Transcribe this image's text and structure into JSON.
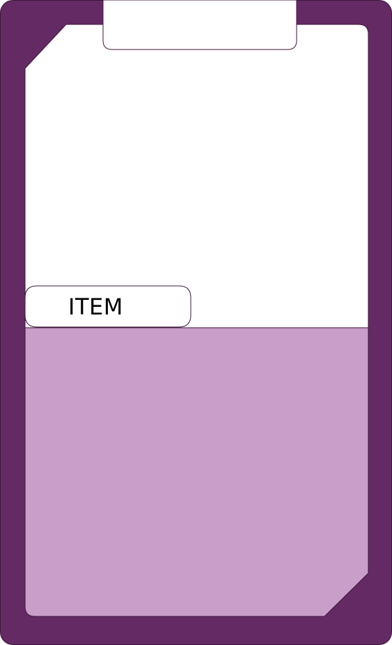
{
  "card": {
    "item_label": "ITEM"
  },
  "colors": {
    "frame": "#642a64",
    "lower_panel": "#c99ec9",
    "upper_panel": "#ffffff",
    "outline": "#3a153a"
  }
}
